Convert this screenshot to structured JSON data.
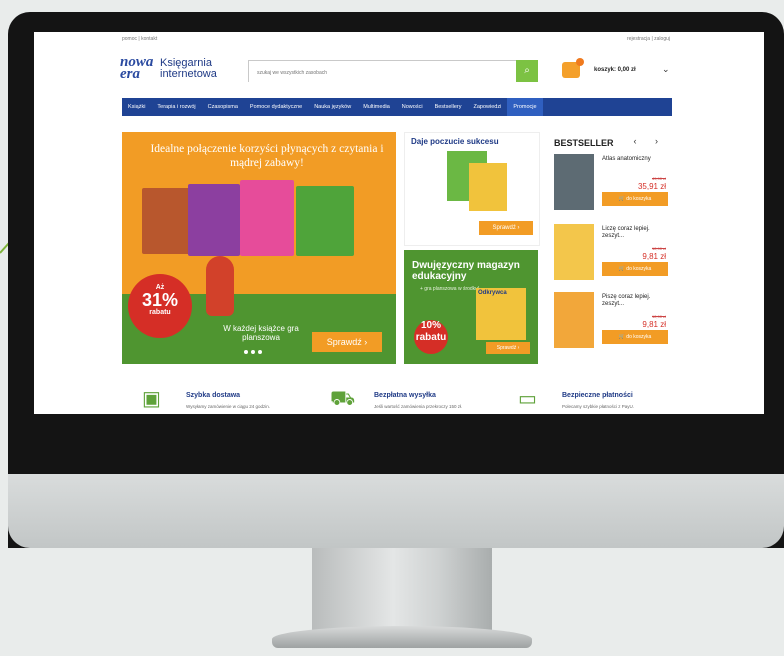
{
  "site": {
    "top_links": {
      "left": "pomoc | kontakt",
      "right": "rejestracja | zaloguj"
    },
    "logo": {
      "mark_line1": "nowa",
      "mark_line2": "era",
      "name": "Księgarnia internetowa"
    },
    "search": {
      "placeholder": "szukaj we wszystkich zasobach"
    },
    "cart": {
      "label": "koszyk: 0,00 zł"
    },
    "nav": [
      "Książki",
      "Terapia i rozwój",
      "Czasopisma",
      "Pomoce dydaktyczne",
      "Nauka języków",
      "Multimedia",
      "Nowości",
      "Bestsellery",
      "Zapowiedzi",
      "Promocje"
    ],
    "hero": {
      "title": "Idealne połączenie korzyści płynących z czytania i mądrej zabawy!",
      "badge_top": "Aż",
      "badge_value": "31%",
      "badge_bottom": "rabatu",
      "subtitle": "W każdej książce gra planszowa",
      "cta": "Sprawdź"
    },
    "promo1": {
      "title": "Daje poczucie sukcesu",
      "cta": "Sprawdź"
    },
    "promo2": {
      "title": "Dwujęzyczny magazyn edukacyjny",
      "subtitle": "+ gra planszowa w środku!",
      "badge": "10% rabatu",
      "book_title": "Odkrywca",
      "cta": "Sprawdź"
    },
    "bestseller": {
      "title": "BESTSELLER",
      "items": [
        {
          "name": "Atlas anatomiczny",
          "old_price": "49,90 zł",
          "price": "35,91 zł",
          "button": "do koszyka"
        },
        {
          "name": "Liczę coraz lepiej. zeszyt...",
          "old_price": "12,90 zł",
          "price": "9,81 zł",
          "button": "do koszyka"
        },
        {
          "name": "Piszę coraz lepiej. zeszyt...",
          "old_price": "12,90 zł",
          "price": "9,81 zł",
          "button": "do koszyka"
        }
      ]
    },
    "features": [
      {
        "title": "Szybka dostawa",
        "desc": "Wysyłamy zamówienie w ciągu 24 godzin."
      },
      {
        "title": "Bezpłatna wysyłka",
        "desc": "Jeśli wartość zamówienia przekroczy 150 zł."
      },
      {
        "title": "Bezpieczne płatności",
        "desc": "Polecamy szybkie płatności z PayU."
      }
    ]
  },
  "colors": {
    "navy": "#1f4394",
    "orange": "#f29c25",
    "green": "#4f9530",
    "red": "#d52e26",
    "lime": "#7cc243"
  }
}
